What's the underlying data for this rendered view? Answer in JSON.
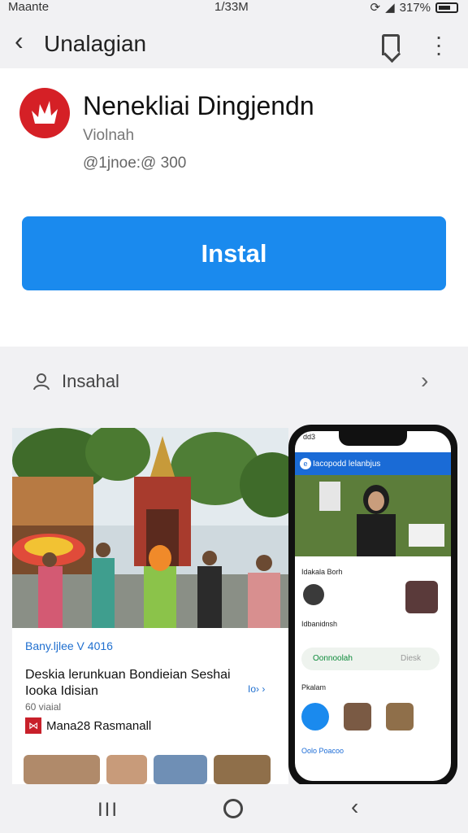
{
  "status_bar": {
    "carrier": "Maante",
    "time": "1/33M",
    "battery": "317%"
  },
  "app_bar": {
    "title": "Unalagian"
  },
  "app": {
    "name": "Nenekliai Dingjendn",
    "publisher": "Violnah",
    "meta": "@1jnoe:@ 300",
    "install_label": "Instal",
    "logo_color": "#d52026",
    "accent_color": "#1a8aee"
  },
  "section": {
    "label": "Insahal"
  },
  "promo": {
    "tag": "Bany.ljlee V 4016",
    "headline": "Deskia lerunkuan Bondieian Seshai Iooka Idisian",
    "arrow": "Io› ›",
    "sub": "60 viaial",
    "brand": "Mana28 Rasmanall"
  },
  "phone_screen": {
    "status": "dd3",
    "header": "Iacopodd lelanbjus",
    "line1": "Idakala Borh",
    "line2": "Idbanidnsh",
    "pill_left": "Oonnoolah",
    "pill_right": "Diesk",
    "line3": "Pkalam",
    "line4": "Oolo Poacoo"
  },
  "nav": {
    "recents": "III",
    "back": "‹"
  }
}
